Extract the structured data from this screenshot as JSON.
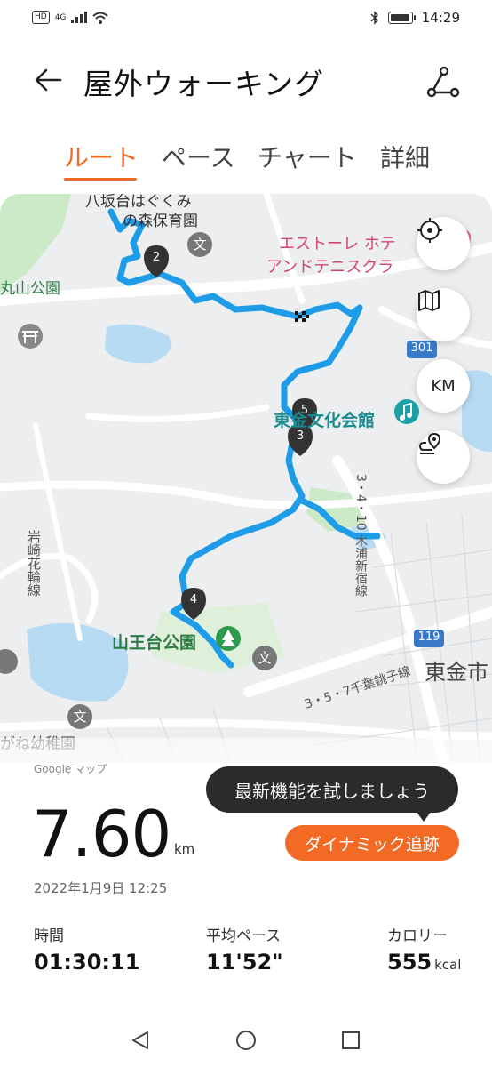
{
  "status_bar": {
    "left_badges": [
      "HD",
      "4G"
    ],
    "time": "14:29",
    "battery_level": 0.8
  },
  "header": {
    "title": "屋外ウォーキング"
  },
  "tabs": [
    {
      "label": "ルート",
      "active": true
    },
    {
      "label": "ペース",
      "active": false
    },
    {
      "label": "チャート",
      "active": false
    },
    {
      "label": "詳細",
      "active": false
    }
  ],
  "map": {
    "labels": {
      "nursery_1": "八坂台はぐくみ",
      "nursery_2": "の森保育園",
      "hotel_1": "エストーレ ホテ",
      "hotel_2": "アンドテニスクラ",
      "park_left": "丸山公園",
      "culture_hall": "東金文化会館",
      "sannodai_park": "山王台公園",
      "road_iwasaki": "岩崎花輪線",
      "road_kinpu": "3・4・10 木浦新宿線",
      "road_chiba": "3・5・7千葉銚子線",
      "road_301": "301",
      "road_119": "119",
      "city": "東金市",
      "school_label": "文",
      "kindergarten": "がね幼稚園",
      "attribution": "Google マップ"
    },
    "markers": [
      "2",
      "5",
      "3",
      "4"
    ],
    "controls": {
      "units": "KM"
    },
    "route_color": "#1e9ce8",
    "accent_color": "#f26a24"
  },
  "summary": {
    "tooltip": "最新機能を試しましょう",
    "dynamic_button": "ダイナミック追跡",
    "distance_value": "7.60",
    "distance_unit": "km",
    "date": "2022年1月9日 12:25",
    "stats": [
      {
        "label": "時間",
        "value": "01:30:11",
        "unit": ""
      },
      {
        "label": "平均ペース",
        "value": "11'52\"",
        "unit": ""
      },
      {
        "label": "カロリー",
        "value": "555",
        "unit": "kcal"
      }
    ]
  }
}
